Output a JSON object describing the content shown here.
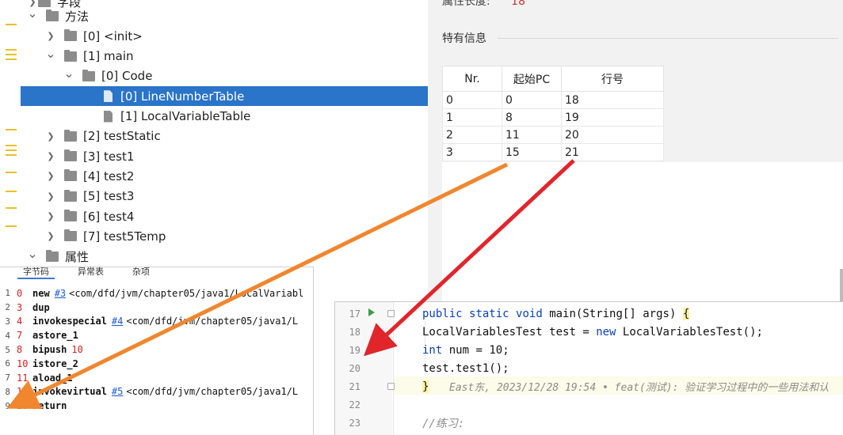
{
  "tree": {
    "cropped_top_label": "字段",
    "nodes": [
      {
        "label": "方法",
        "level": 0,
        "expanded": true,
        "kind": "folder"
      },
      {
        "label": "[0] <init>",
        "level": 1,
        "expanded": false,
        "kind": "folder"
      },
      {
        "label": "[1] main",
        "level": 1,
        "expanded": true,
        "kind": "folder"
      },
      {
        "label": "[0] Code",
        "level": 2,
        "expanded": true,
        "kind": "folder"
      },
      {
        "label": "[0] LineNumberTable",
        "level": 3,
        "kind": "file",
        "selected": true
      },
      {
        "label": "[1] LocalVariableTable",
        "level": 3,
        "kind": "file"
      },
      {
        "label": "[2] testStatic",
        "level": 1,
        "expanded": false,
        "kind": "folder"
      },
      {
        "label": "[3] test1",
        "level": 1,
        "expanded": false,
        "kind": "folder"
      },
      {
        "label": "[4] test2",
        "level": 1,
        "expanded": false,
        "kind": "folder"
      },
      {
        "label": "[5] test3",
        "level": 1,
        "expanded": false,
        "kind": "folder"
      },
      {
        "label": "[6] test4",
        "level": 1,
        "expanded": false,
        "kind": "folder"
      },
      {
        "label": "[7] test5Temp",
        "level": 1,
        "expanded": false,
        "kind": "folder"
      },
      {
        "label": "属性",
        "level": 0,
        "expanded": true,
        "kind": "folder"
      }
    ]
  },
  "info": {
    "attr_length_label": "属性长度:",
    "attr_length_value": "18",
    "special_info_title": "特有信息",
    "table": {
      "columns": [
        "Nr.",
        "起始PC",
        "行号"
      ],
      "rows": [
        [
          "0",
          "0",
          "18"
        ],
        [
          "1",
          "8",
          "19"
        ],
        [
          "2",
          "11",
          "20"
        ],
        [
          "3",
          "15",
          "21"
        ]
      ]
    }
  },
  "bytecode": {
    "tabs": [
      "字节码",
      "异常表",
      "杂项"
    ],
    "lines": [
      {
        "ln": "1",
        "offset": "0",
        "op": "new",
        "ref": "#3",
        "arg": "<com/dfd/jvm/chapter05/java1/LocalVariabl"
      },
      {
        "ln": "2",
        "offset": "3",
        "op": "dup"
      },
      {
        "ln": "3",
        "offset": "4",
        "op": "invokespecial",
        "ref": "#4",
        "arg": "<com/dfd/jvm/chapter05/java1/L"
      },
      {
        "ln": "4",
        "offset": "7",
        "op": "astore_1"
      },
      {
        "ln": "5",
        "offset": "8",
        "op": "bipush",
        "num": "10"
      },
      {
        "ln": "6",
        "offset": "10",
        "op": "istore_2"
      },
      {
        "ln": "7",
        "offset": "11",
        "op": "aload_1"
      },
      {
        "ln": "8",
        "offset": "12",
        "op": "invokevirtual",
        "ref": "#5",
        "arg": "<com/dfd/jvm/chapter05/java1/L"
      },
      {
        "ln": "9",
        "offset": "15",
        "op": "return"
      }
    ]
  },
  "editor": {
    "lines": [
      {
        "ln": "17",
        "code": "public static void main(String[] args) {"
      },
      {
        "ln": "18",
        "code": "    LocalVariablesTest test = new LocalVariablesTest();"
      },
      {
        "ln": "19",
        "code": "    int num = 10;"
      },
      {
        "ln": "20",
        "code": "    test.test1();"
      },
      {
        "ln": "21",
        "code": "}",
        "blame": "East东, 2023/12/28 19:54 • feat(测试): 验证学习过程中的一些用法和认"
      },
      {
        "ln": "22",
        "code": ""
      },
      {
        "ln": "23",
        "code": "    //练习:"
      }
    ]
  },
  "colors": {
    "selection": "#2a74c9",
    "orange_arrow": "#f0862e",
    "red_arrow": "#e0262b",
    "offset_red": "#d21f1f",
    "keyword_blue": "#0b3fb8",
    "gutter_mark": "#e8c12a"
  }
}
